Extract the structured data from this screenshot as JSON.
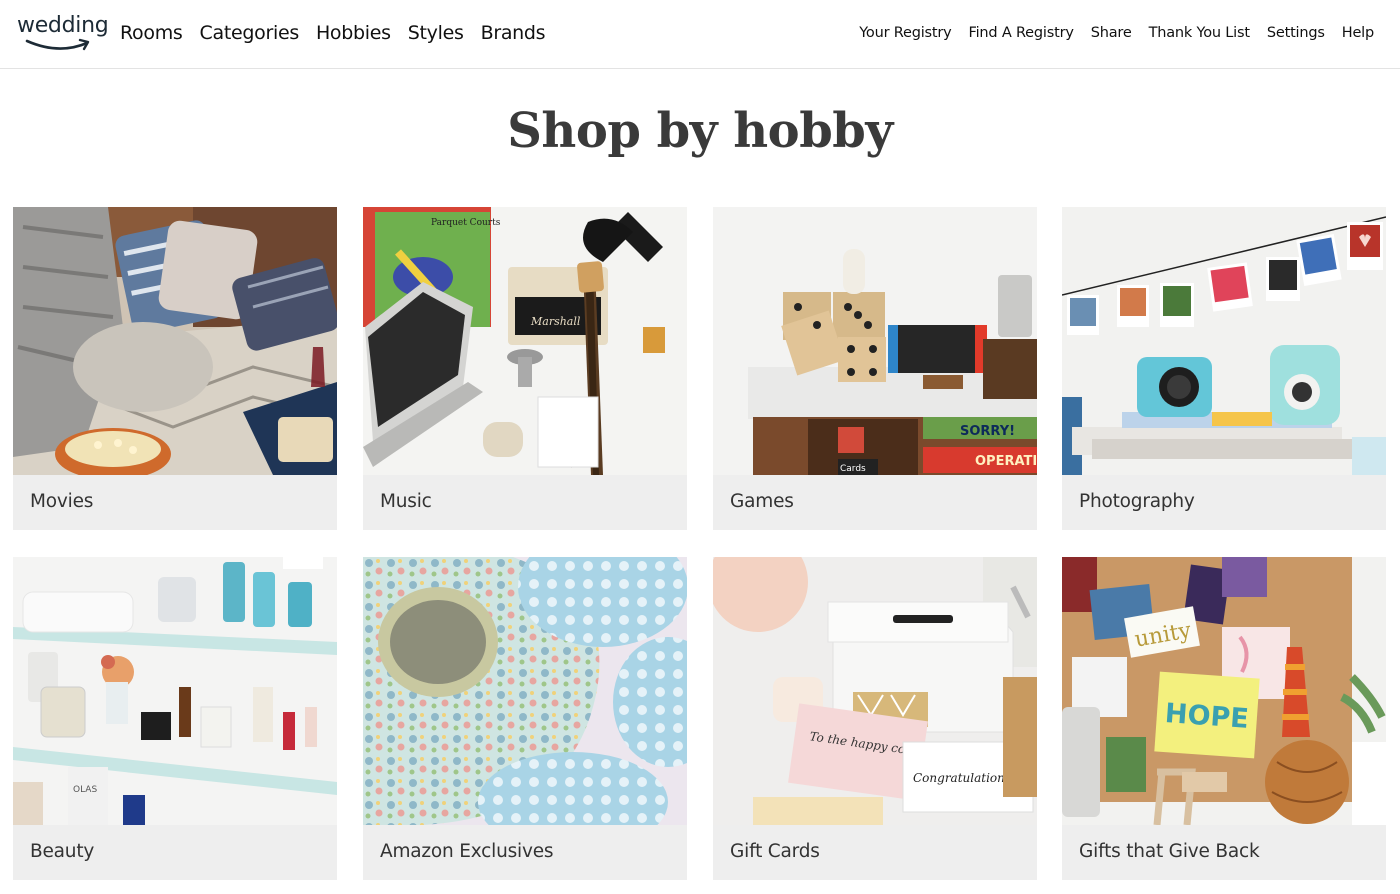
{
  "brand": {
    "logo_text": "wedding"
  },
  "main_nav": [
    {
      "label": "Rooms"
    },
    {
      "label": "Categories"
    },
    {
      "label": "Hobbies"
    },
    {
      "label": "Styles"
    },
    {
      "label": "Brands"
    }
  ],
  "sub_nav": [
    {
      "label": "Your Registry"
    },
    {
      "label": "Find A Registry"
    },
    {
      "label": "Share"
    },
    {
      "label": "Thank You List"
    },
    {
      "label": "Settings"
    },
    {
      "label": "Help"
    }
  ],
  "page": {
    "title": "Shop by hobby"
  },
  "hobbies": [
    {
      "label": "Movies"
    },
    {
      "label": "Music",
      "photo_text": {
        "record": "Parquet Courts",
        "amp": "Marshall"
      }
    },
    {
      "label": "Games",
      "photo_text": {
        "box1": "SORRY!",
        "box2": "OPERATION",
        "cards": "Cards"
      }
    },
    {
      "label": "Photography"
    },
    {
      "label": "Beauty",
      "photo_text": {
        "bottle": "OLAS"
      }
    },
    {
      "label": "Amazon Exclusives"
    },
    {
      "label": "Gift Cards",
      "photo_text": {
        "card1": "To the happy couple",
        "card2": "Congratulations"
      }
    },
    {
      "label": "Gifts that Give Back",
      "photo_text": {
        "word1": "unity",
        "word2": "HOPE"
      }
    }
  ],
  "colors": {
    "header_border": "#e3e3e3",
    "tile_bg": "#eeeeee",
    "title": "#3a3a3a",
    "logo_smile": "#1d2b36"
  }
}
